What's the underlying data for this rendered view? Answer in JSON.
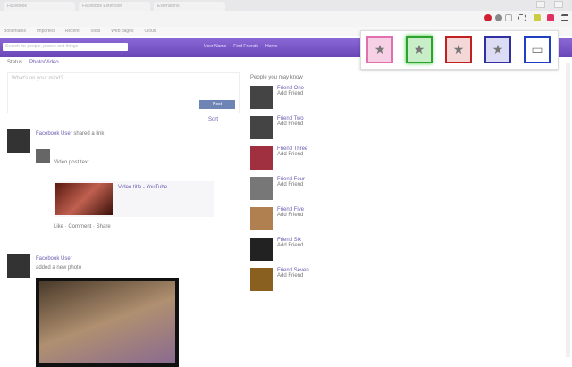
{
  "browser": {
    "tabs": [
      "Facebook",
      "Facebook Extension",
      "Extensions"
    ]
  },
  "bookmarks": [
    "Bookmarks",
    "Imported",
    "Recent",
    "Tools",
    "Web pages",
    "Cloud"
  ],
  "fb": {
    "search_placeholder": "Search for people, places and things",
    "nav": [
      "User Name",
      "Find Friends",
      "Home"
    ]
  },
  "composer": {
    "tabs": [
      "Status",
      "Photo/Video"
    ],
    "placeholder": "What's on your mind?",
    "post_label": "Post",
    "sort": "Sort"
  },
  "stories": [
    {
      "author": "Facebook User",
      "meta": "shared a link",
      "text": "Video post text...",
      "link_title": "Video title - YouTube",
      "actions": "Like · Comment · Share"
    },
    {
      "author": "Facebook User",
      "meta": "added a new photo"
    }
  ],
  "sidebar": {
    "title": "People you may know",
    "items": [
      "Friend One",
      "Friend Two",
      "Friend Three",
      "Friend Four",
      "Friend Five",
      "Friend Six",
      "Friend Seven"
    ],
    "add_label": "Add Friend"
  },
  "popup": {
    "colors": [
      "#e070b0",
      "#30a030",
      "#c02020",
      "#3030a0",
      "#2040c0"
    ]
  }
}
